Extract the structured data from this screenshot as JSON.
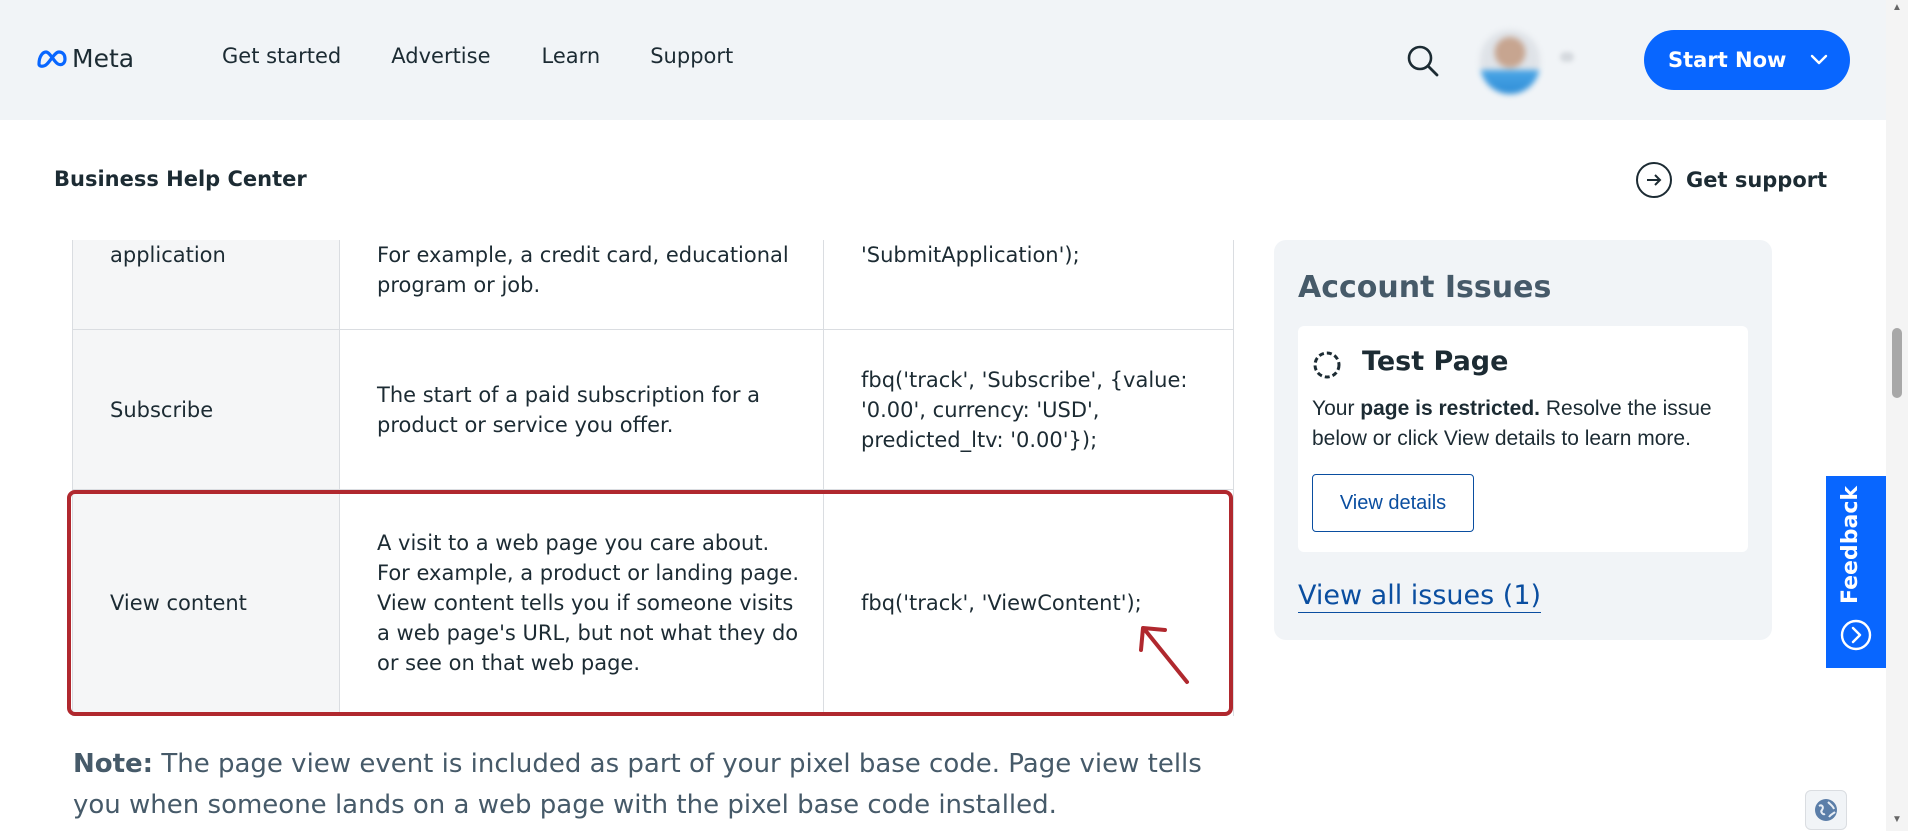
{
  "nav": {
    "logo_text": "Meta",
    "links": [
      "Get started",
      "Advertise",
      "Learn",
      "Support"
    ],
    "start_button": "Start Now"
  },
  "subheader": {
    "title": "Business Help Center",
    "support_link": "Get support"
  },
  "table": {
    "rows": [
      {
        "event": "application",
        "description": "For example, a credit card, educational program or job.",
        "code": "'SubmitApplication');"
      },
      {
        "event": "Subscribe",
        "description": "The start of a paid subscription for a product or service you offer.",
        "code": "fbq('track', 'Subscribe', {value: '0.00', currency: 'USD', predicted_ltv: '0.00'});"
      },
      {
        "event": "View content",
        "description": "A visit to a web page you care about. For example, a product or landing page. View content tells you if someone visits a web page's URL, but not what they do or see on that web page.",
        "code": "fbq('track', 'ViewContent');"
      }
    ]
  },
  "note": {
    "label": "Note:",
    "text": " The page view event is included as part of your pixel base code. Page view tells you when someone lands on a web page with the pixel base code installed."
  },
  "account_issues": {
    "title": "Account Issues",
    "page_name": "Test Page",
    "message_prefix": "Your ",
    "message_bold": "page is restricted.",
    "message_suffix": " Resolve the issue below or click View details to learn more.",
    "view_details": "View details",
    "view_all": "View all issues (1)"
  },
  "feedback": {
    "label": "Feedback"
  },
  "colors": {
    "primary": "#0866ff",
    "highlight_border": "#b0282e",
    "link": "#0a4ea0",
    "text": "#1c2b33"
  },
  "icons": [
    "meta-logo-icon",
    "search-icon",
    "avatar",
    "chevron-down-icon",
    "arrow-right-circle-icon",
    "spinner-icon",
    "chevron-right-circle-icon",
    "globe-icon",
    "annotation-arrow"
  ]
}
